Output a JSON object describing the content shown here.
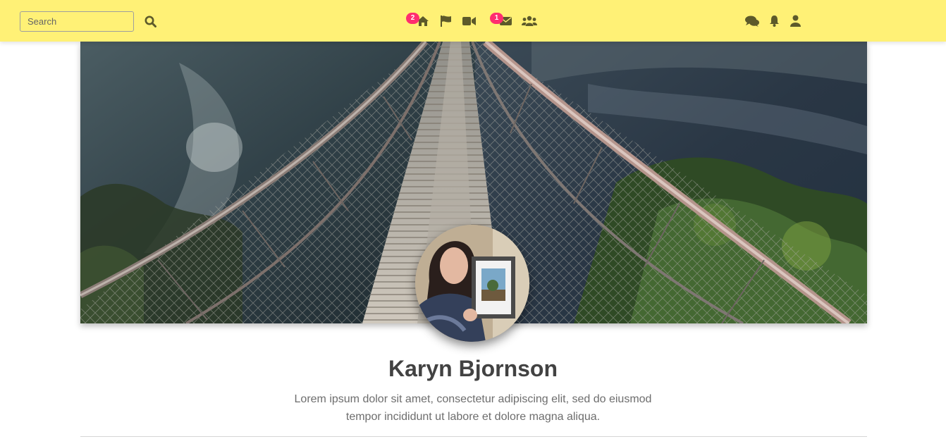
{
  "search": {
    "placeholder": "Search"
  },
  "nav": {
    "items": [
      {
        "icon": "home-icon",
        "badge": "2"
      },
      {
        "icon": "flag-icon",
        "badge": ""
      },
      {
        "icon": "video-icon",
        "badge": ""
      },
      {
        "icon": "envelope-icon",
        "badge": "1"
      },
      {
        "icon": "users-icon",
        "badge": ""
      }
    ],
    "right": [
      "chat-icon",
      "bell-icon",
      "user-icon"
    ]
  },
  "colors": {
    "topbar": "#fff176",
    "badge": "#ff2d6f",
    "icon": "#5d5a2a",
    "name": "#424242",
    "bio": "#6d6d6d"
  },
  "profile": {
    "name": "Karyn Bjornson",
    "bio": "Lorem ipsum dolor sit amet, consectetur adipiscing elit, sed do eiusmod tempor incididunt ut labore et dolore magna aliqua."
  }
}
